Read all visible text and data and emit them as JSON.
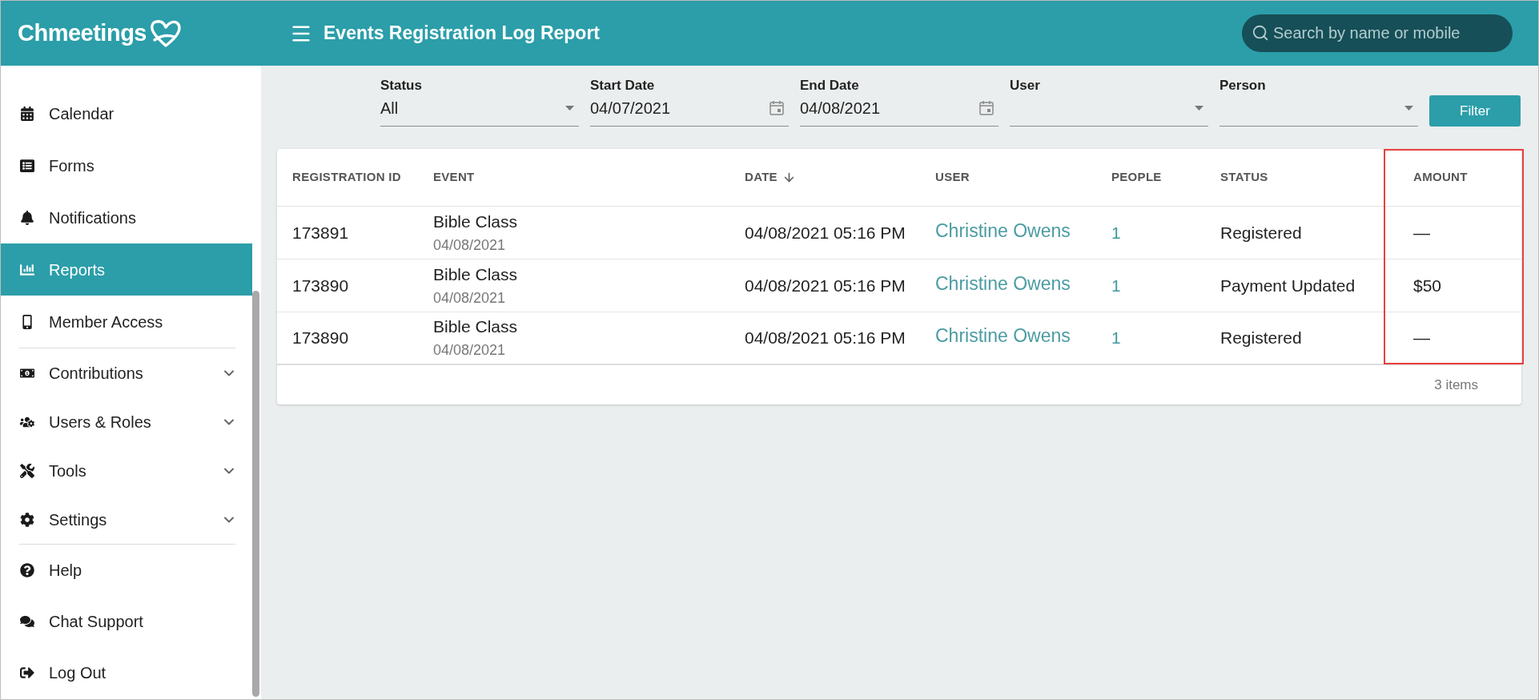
{
  "header": {
    "logo": "Chmeetings",
    "title": "Events Registration Log Report",
    "search": {
      "placeholder": "Search by name or mobile"
    }
  },
  "sidebar": {
    "sections": [
      {
        "items": [
          {
            "label": "Calendar",
            "selected": false
          },
          {
            "label": "Forms",
            "selected": false
          },
          {
            "label": "Notifications",
            "selected": false
          },
          {
            "label": "Reports",
            "selected": true
          },
          {
            "label": "Member Access",
            "selected": false
          }
        ]
      },
      {
        "items": [
          {
            "label": "Contributions",
            "selected": false,
            "expanded": false
          },
          {
            "label": "Users & Roles",
            "selected": false,
            "expanded": false
          },
          {
            "label": "Tools",
            "selected": false,
            "expanded": false
          },
          {
            "label": "Settings",
            "selected": false,
            "expanded": false
          }
        ]
      },
      {
        "items": [
          {
            "label": "Help",
            "selected": false
          },
          {
            "label": "Chat Support",
            "selected": false
          },
          {
            "label": "Log Out",
            "selected": false
          }
        ]
      }
    ]
  },
  "filters": {
    "fields": [
      {
        "kind": "select",
        "label": "Status",
        "value": "All"
      },
      {
        "kind": "date",
        "label": "Start Date",
        "value": "04/07/2021"
      },
      {
        "kind": "date",
        "label": "End Date",
        "value": "04/08/2021"
      },
      {
        "kind": "select",
        "label": "User"
      },
      {
        "kind": "select",
        "label": "Person"
      }
    ],
    "button": "Filter"
  },
  "table": {
    "columns": [
      {
        "label": "REGISTRATION ID",
        "sorted": false,
        "highlighted": false
      },
      {
        "label": "EVENT",
        "sorted": false,
        "highlighted": false
      },
      {
        "label": "DATE",
        "sorted": true,
        "highlighted": false
      },
      {
        "label": "USER",
        "sorted": false,
        "highlighted": false
      },
      {
        "label": "PEOPLE",
        "sorted": false,
        "highlighted": false
      },
      {
        "label": "STATUS",
        "sorted": false,
        "highlighted": false
      },
      {
        "label": "AMOUNT",
        "sorted": false,
        "highlighted": true
      }
    ],
    "rows": [
      {
        "registration_id": "173891",
        "event": {
          "name": "Bible Class",
          "date": "04/08/2021"
        },
        "date": "04/08/2021 05:16 PM",
        "user": "Christine Owens",
        "people": "1",
        "status": "Registered",
        "amount": "—"
      },
      {
        "registration_id": "173890",
        "event": {
          "name": "Bible Class",
          "date": "04/08/2021"
        },
        "date": "04/08/2021 05:16 PM",
        "user": "Christine Owens",
        "people": "1",
        "status": "Payment Updated",
        "amount": "$50"
      },
      {
        "registration_id": "173890",
        "event": {
          "name": "Bible Class",
          "date": "04/08/2021"
        },
        "date": "04/08/2021 05:16 PM",
        "user": "Christine Owens",
        "people": "1",
        "status": "Registered",
        "amount": "—"
      }
    ],
    "footer": "3 items"
  }
}
